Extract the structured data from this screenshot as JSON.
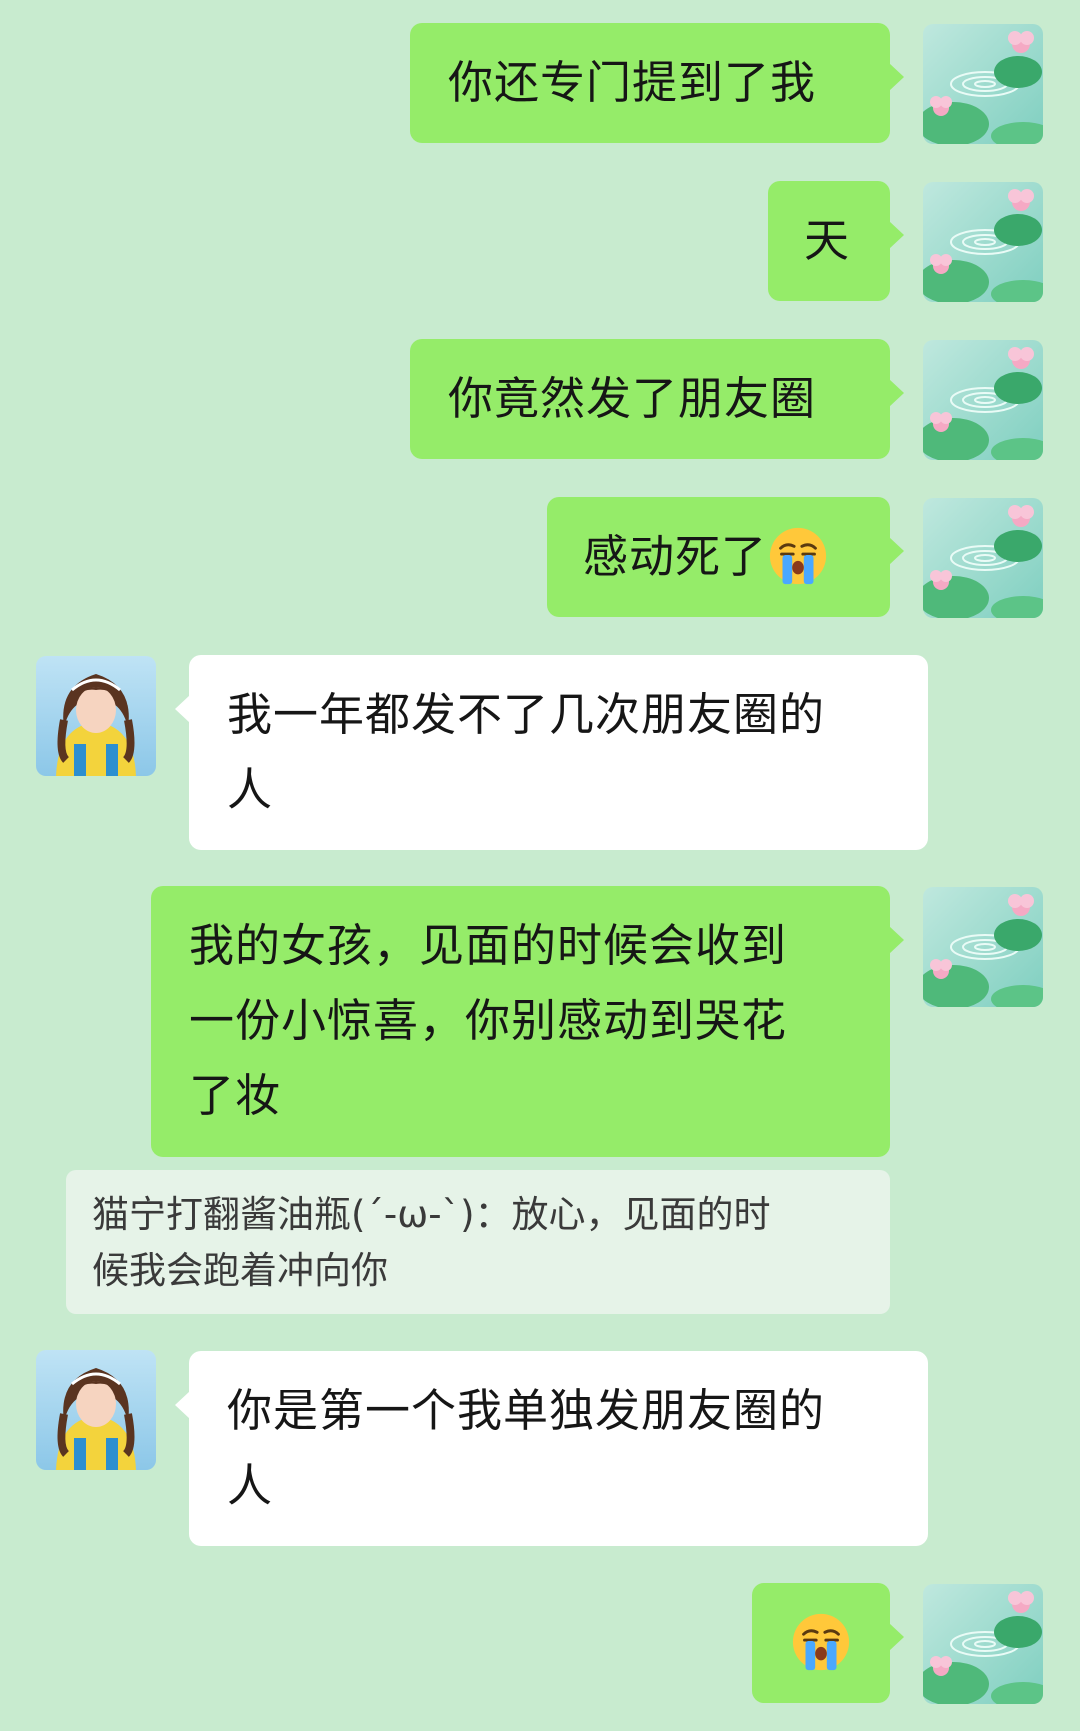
{
  "messages": [
    {
      "text": "你还专门提到了我"
    },
    {
      "text": "天"
    },
    {
      "text": "你竟然发了朋友圈"
    },
    {
      "text": "感动死了",
      "emoji": "loudly-crying-face"
    },
    {
      "text_lines": [
        "我一年都发不了几次朋友圈的",
        "人"
      ]
    },
    {
      "text_lines": [
        "我的女孩，见面的时候会收到",
        "一份小惊喜，你别感动到哭花",
        "了妆"
      ]
    },
    {
      "text_lines": [
        "你是第一个我单独发朋友圈的",
        "人"
      ]
    },
    {
      "emoji": "loudly-crying-face"
    }
  ],
  "quote": {
    "lines": [
      "猫宁打翻酱油瓶(ˊ-ω-ˋ)：放心，见面的时",
      "候我会跑着冲向你"
    ]
  },
  "colors": {
    "chat_background": "#c8ebcf",
    "sent_bubble": "#95ec69",
    "received_bubble": "#ffffff",
    "quote_background": "#e6f3e8"
  }
}
